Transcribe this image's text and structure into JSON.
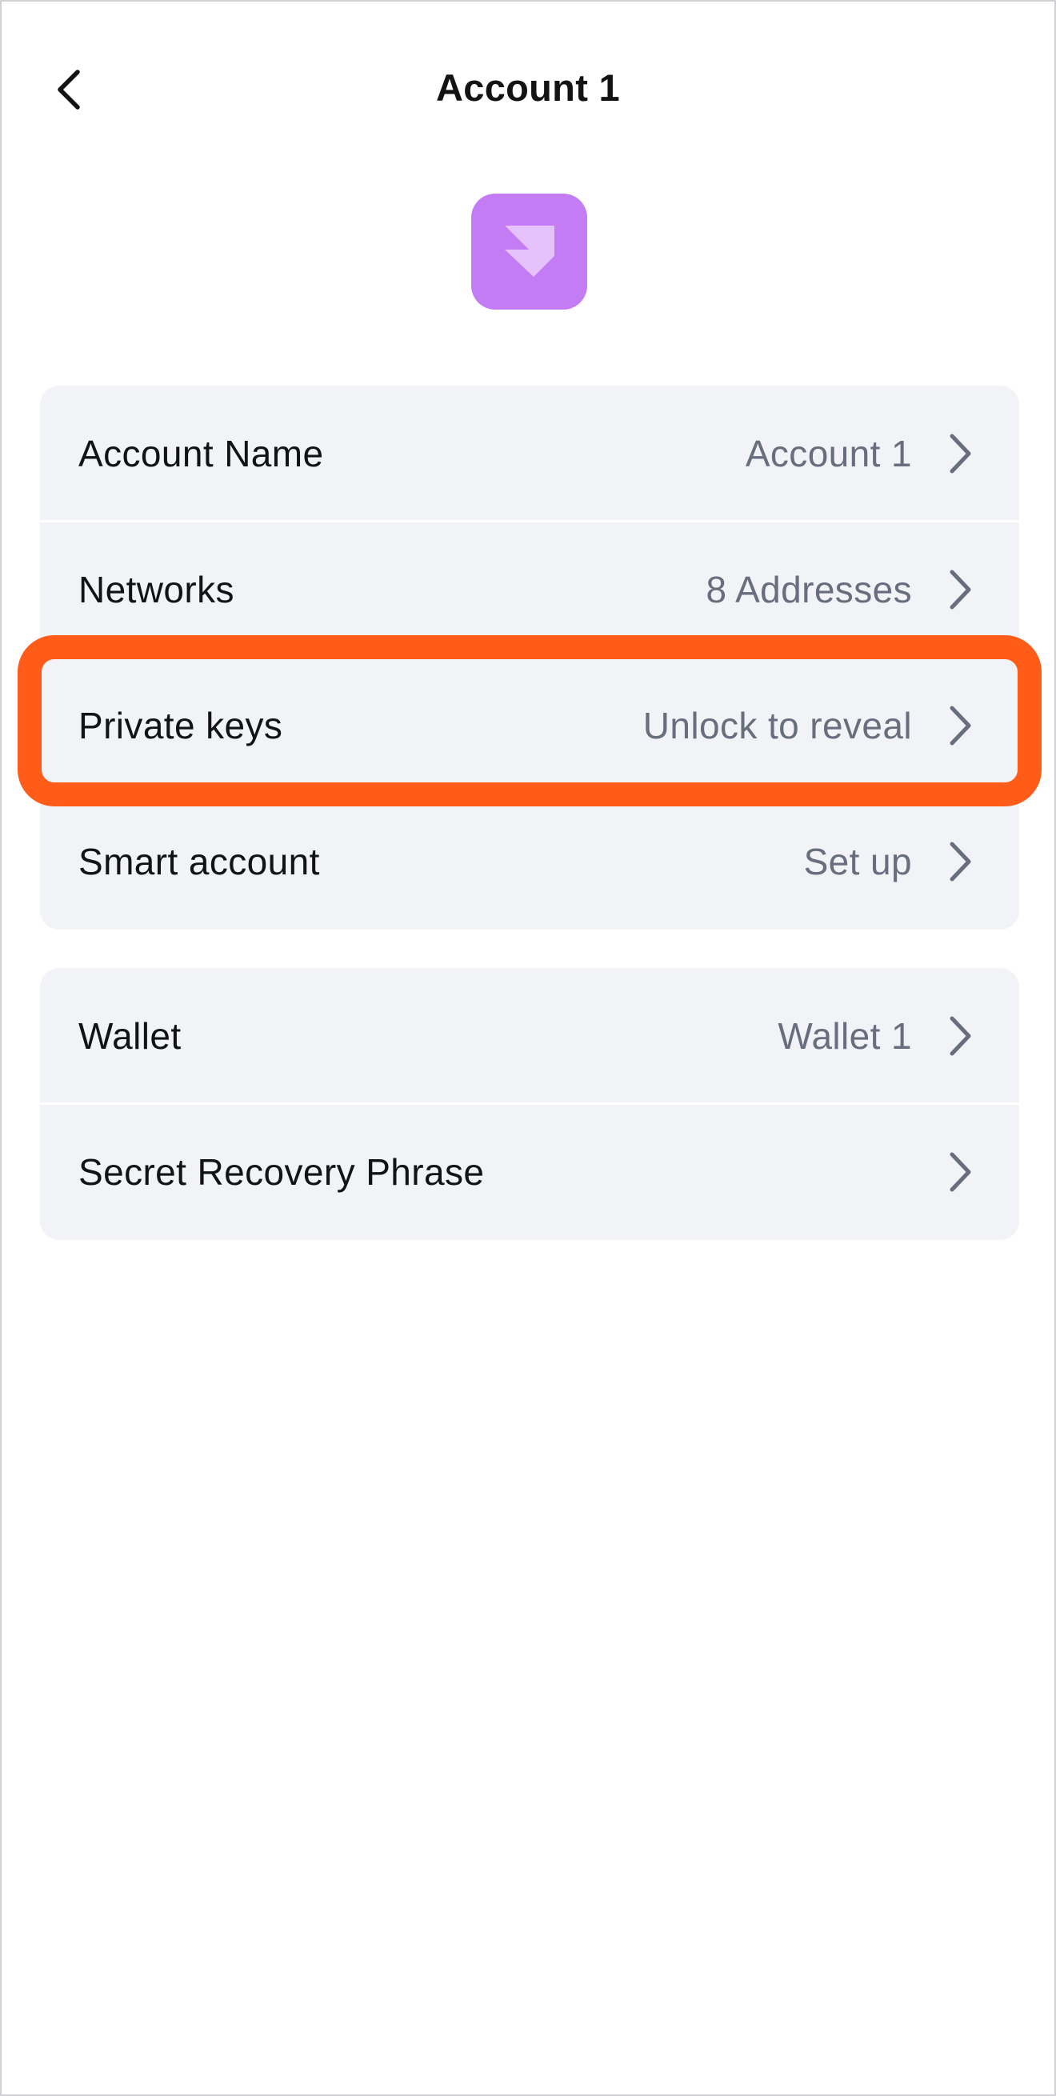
{
  "header": {
    "title": "Account 1"
  },
  "accent_colors": {
    "avatar": "#c47cf5",
    "highlight": "#ff5c1a"
  },
  "account_group": {
    "rows": [
      {
        "label": "Account Name",
        "value": "Account 1"
      },
      {
        "label": "Networks",
        "value": "8 Addresses"
      },
      {
        "label": "Private keys",
        "value": "Unlock to reveal"
      },
      {
        "label": "Smart account",
        "value": "Set up"
      }
    ]
  },
  "wallet_group": {
    "rows": [
      {
        "label": "Wallet",
        "value": "Wallet 1"
      },
      {
        "label": "Secret Recovery Phrase",
        "value": ""
      }
    ]
  },
  "icons": {
    "back": "chevron-left-icon",
    "row_arrow": "chevron-right-icon",
    "avatar": "account-identicon"
  }
}
